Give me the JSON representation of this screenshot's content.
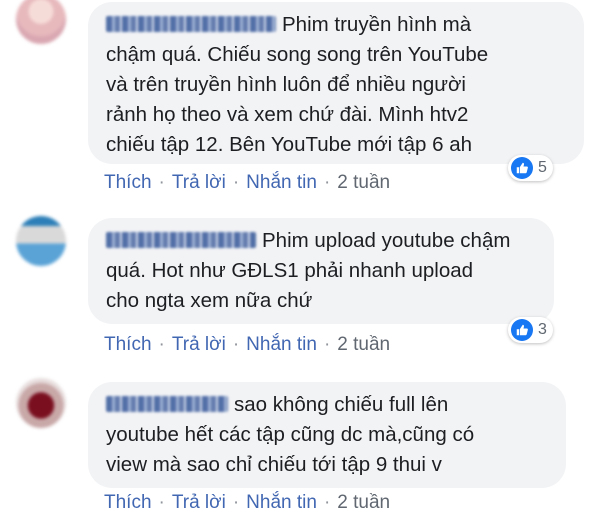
{
  "comments": [
    {
      "text_lines": [
        "Phim truyền hình mà",
        "chậm quá. Chiếu song song trên YouTube",
        "và trên truyền hình luôn để nhiều người",
        "rảnh họ theo và xem chứ đài. Mình htv2",
        "chiếu tập 12. Bên YouTube mới tập 6 ah"
      ],
      "reaction_count": "5",
      "like_label": "Thích",
      "reply_label": "Trả lời",
      "message_label": "Nhắn tin",
      "time": "2 tuần"
    },
    {
      "text_lines": [
        "Phim upload youtube chậm",
        "quá. Hot như GĐLS1 phải nhanh upload",
        "cho ngta xem nữa chứ"
      ],
      "reaction_count": "3",
      "like_label": "Thích",
      "reply_label": "Trả lời",
      "message_label": "Nhắn tin",
      "time": "2 tuần"
    },
    {
      "text_lines": [
        "sao không chiếu full lên",
        "youtube hết các tập cũng dc mà,cũng có",
        "view mà sao chỉ chiếu tới tập 9 thui v"
      ],
      "like_label": "Thích",
      "reply_label": "Trả lời",
      "message_label": "Nhắn tin",
      "time": "2 tuần"
    }
  ],
  "separator": "·",
  "colors": {
    "bubble_bg": "#f2f3f5",
    "link": "#4267b2",
    "muted": "#606770",
    "like_blue": "#1877f2",
    "name_blue": "#365899"
  },
  "icons": [
    "avatar",
    "like-icon"
  ]
}
